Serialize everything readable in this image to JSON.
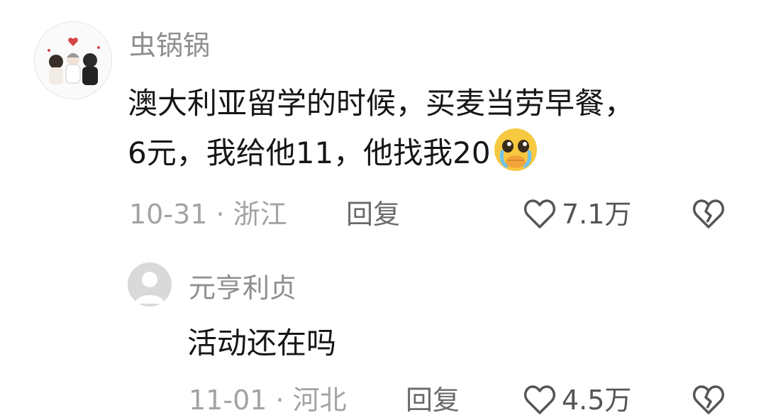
{
  "comment": {
    "username": "虫锅锅",
    "text_line1": "澳大利亚留学的时候，买麦当劳早餐，",
    "text_line2": "6元，我给他11，他找我20",
    "emoji_icon": "pleading-face-emoji",
    "date_location": "10-31 · 浙江",
    "reply_label": "回复",
    "like_count": "7.1万",
    "like_icon": "heart-outline-icon",
    "dislike_icon": "broken-heart-icon"
  },
  "reply": {
    "username": "元亨利贞",
    "text": "活动还在吗",
    "date_location": "11-01 · 河北",
    "reply_label": "回复",
    "like_count": "4.5万",
    "like_icon": "heart-outline-icon",
    "dislike_icon": "broken-heart-icon"
  },
  "colors": {
    "username": "#8e8e8e",
    "text": "#161616",
    "meta": "#a3a3a3",
    "icon": "#555555"
  }
}
